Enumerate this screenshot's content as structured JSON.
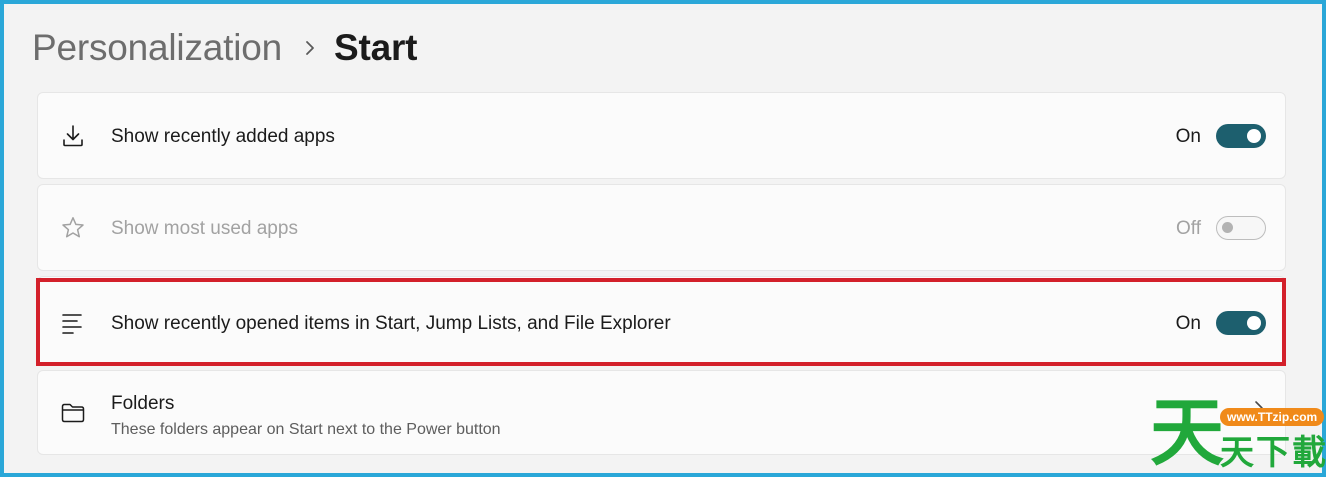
{
  "breadcrumb": {
    "parent": "Personalization",
    "separator_icon": "chevron-right-icon",
    "current": "Start"
  },
  "settings": [
    {
      "icon": "download-icon",
      "label": "Show recently added apps",
      "state_text": "On",
      "toggle_on": true,
      "enabled": true
    },
    {
      "icon": "star-icon",
      "label": "Show most used apps",
      "state_text": "Off",
      "toggle_on": false,
      "enabled": false
    },
    {
      "icon": "list-icon",
      "label": "Show recently opened items in Start, Jump Lists, and File Explorer",
      "state_text": "On",
      "toggle_on": true,
      "enabled": true,
      "highlighted": true
    },
    {
      "icon": "folder-icon",
      "label": "Folders",
      "description": "These folders appear on Start next to the Power button",
      "trailing_icon": "chevron-right-icon"
    }
  ],
  "watermark": {
    "big_char": "天",
    "small_text": "天下載",
    "url": "www.TTzip.com"
  },
  "colors": {
    "toggle_on": "#1d5f6e",
    "highlight_border": "#d3202a",
    "frame": "#2aa7d8",
    "watermark_green": "#21a83b",
    "watermark_orange": "#f08a1a"
  }
}
